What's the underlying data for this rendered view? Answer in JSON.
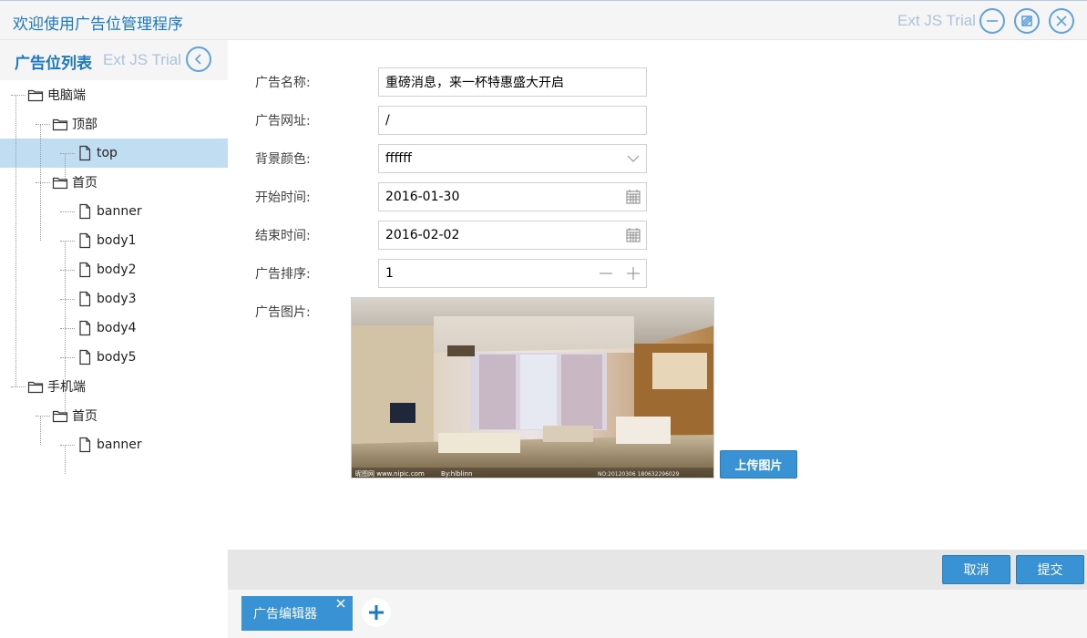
{
  "window": {
    "title": "欢迎使用广告位管理程序",
    "trial": "Ext JS Trial"
  },
  "left_panel": {
    "title": "广告位列表",
    "trial": "Ext JS Trial"
  },
  "tree": [
    {
      "label": "电脑端",
      "type": "folder",
      "depth": 0
    },
    {
      "label": "顶部",
      "type": "folder",
      "depth": 1
    },
    {
      "label": "top",
      "type": "file",
      "depth": 2,
      "selected": true
    },
    {
      "label": "首页",
      "type": "folder",
      "depth": 1
    },
    {
      "label": "banner",
      "type": "file",
      "depth": 2
    },
    {
      "label": "body1",
      "type": "file",
      "depth": 2
    },
    {
      "label": "body2",
      "type": "file",
      "depth": 2
    },
    {
      "label": "body3",
      "type": "file",
      "depth": 2
    },
    {
      "label": "body4",
      "type": "file",
      "depth": 2
    },
    {
      "label": "body5",
      "type": "file",
      "depth": 2
    },
    {
      "label": "手机端",
      "type": "folder",
      "depth": 0
    },
    {
      "label": "首页",
      "type": "folder",
      "depth": 1
    },
    {
      "label": "banner",
      "type": "file",
      "depth": 2
    }
  ],
  "form": {
    "name": {
      "label": "广告名称:",
      "value": "重磅消息，来一杯特惠盛大开启"
    },
    "url": {
      "label": "广告网址:",
      "value": "/"
    },
    "bgcolor": {
      "label": "背景颜色:",
      "value": "ffffff"
    },
    "start": {
      "label": "开始时间:",
      "value": "2016-01-30"
    },
    "end": {
      "label": "结束时间:",
      "value": "2016-02-02"
    },
    "order": {
      "label": "广告排序:",
      "value": "1"
    },
    "image": {
      "label": "广告图片:",
      "watermark_left": "昵图网 www.nipic.com",
      "watermark_mid": "By:hlblinn",
      "watermark_right": "NO:20120306 180632296029"
    },
    "upload_label": "上传图片"
  },
  "footer": {
    "cancel_label": "取消",
    "submit_label": "提交"
  },
  "tabs": [
    {
      "label": "广告编辑器"
    }
  ],
  "colors": {
    "accent": "#3892d4",
    "title": "#1d78c4",
    "selected_row": "#c1ddf1"
  }
}
